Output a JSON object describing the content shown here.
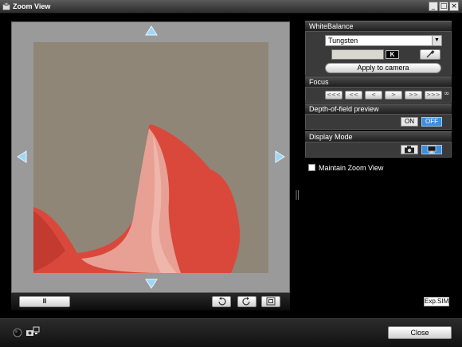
{
  "window": {
    "title": "Zoom View",
    "controls": {
      "minimize": "_",
      "maximize": "□",
      "close": "×"
    }
  },
  "viewer": {
    "image": "zoomed-red-petal-on-beige",
    "arrows": [
      "up-arrow-icon",
      "down-arrow-icon",
      "left-arrow-icon",
      "right-arrow-icon"
    ],
    "playback_label": "II",
    "toolbar_icons": [
      "rotate-left-icon",
      "rotate-right-icon",
      "fit-view-icon"
    ]
  },
  "white_balance": {
    "header": "WhiteBalance",
    "selected": "Tungsten",
    "kelvin_value": "",
    "kelvin_unit": "K",
    "eyedropper_icon": "eyedropper-icon",
    "apply_label": "Apply to camera"
  },
  "focus": {
    "header": "Focus",
    "buttons": [
      "<<<",
      "<<",
      "<",
      ">",
      ">>",
      ">>>"
    ],
    "infinity": "∞"
  },
  "dof_preview": {
    "header": "Depth-of-field preview",
    "on_label": "ON",
    "off_label": "OFF",
    "state": "OFF"
  },
  "display_mode": {
    "header": "Display Mode",
    "modes": [
      "camera-icon",
      "pc-monitor-icon"
    ],
    "selected": "pc-monitor-icon"
  },
  "maintain_zoom": {
    "label": "Maintain Zoom View",
    "checked": false
  },
  "exposure_sim": "Exp.SIM",
  "footer": {
    "close_label": "Close",
    "status_icons": [
      "status-indicator-icon",
      "camera-connection-icon"
    ]
  },
  "colors": {
    "petal_red": "#d9483b",
    "background_beige": "#8f8677",
    "panel_gray": "#3a3a3a",
    "off_active": "#3f8ede"
  }
}
